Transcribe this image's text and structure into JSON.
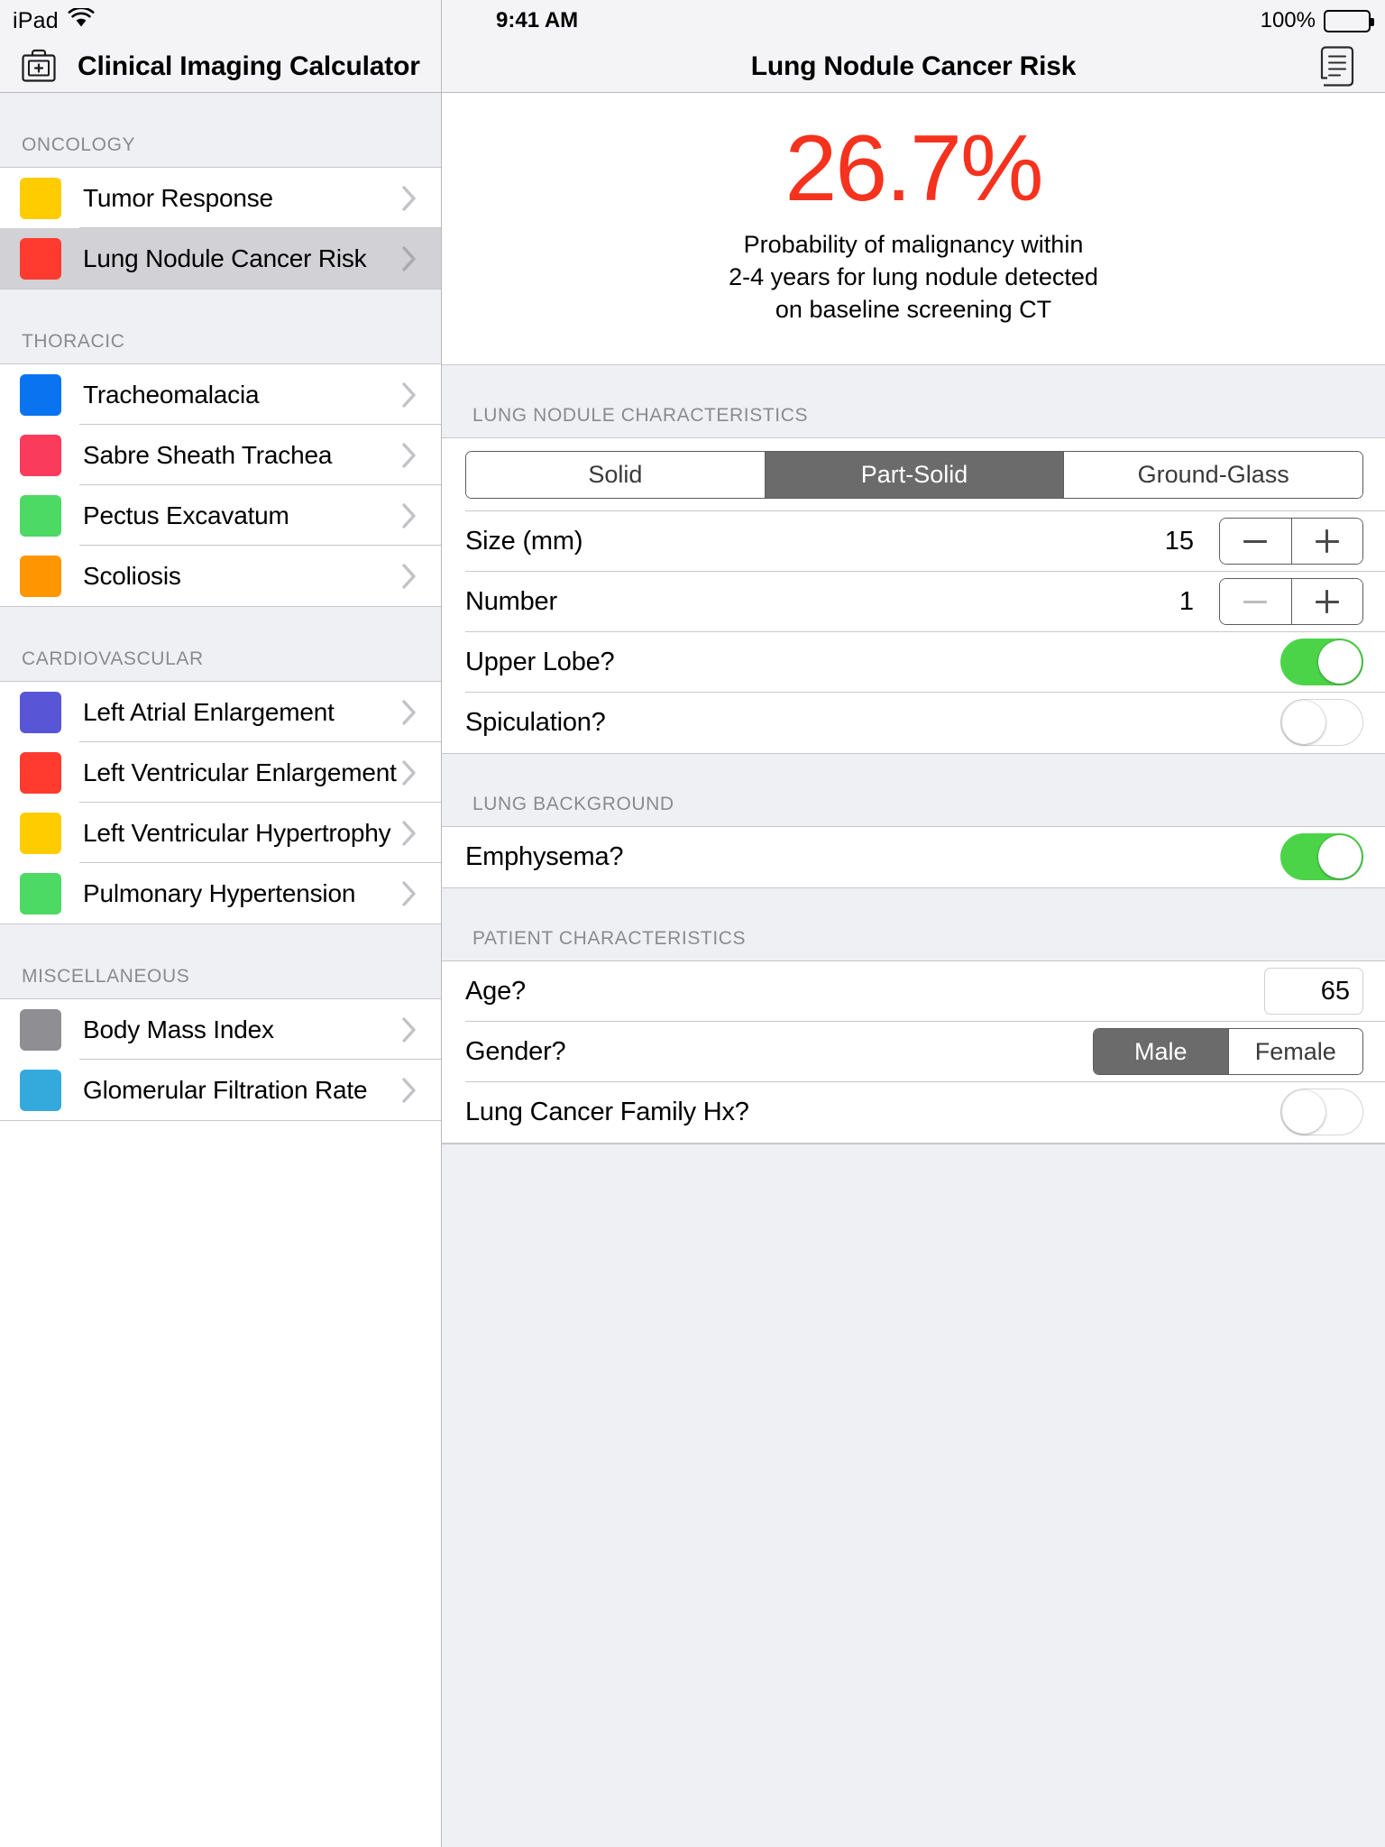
{
  "sidebar": {
    "status": {
      "device": "iPad",
      "wifi_icon": "wifi-icon"
    },
    "app_icon": "medical-bag-icon",
    "title": "Clinical Imaging Calculator",
    "sections": [
      {
        "header": "ONCOLOGY",
        "items": [
          {
            "label": "Tumor Response",
            "color": "#FFCC00",
            "selected": false
          },
          {
            "label": "Lung Nodule Cancer Risk",
            "color": "#FF3B30",
            "selected": true
          }
        ]
      },
      {
        "header": "THORACIC",
        "items": [
          {
            "label": "Tracheomalacia",
            "color": "#0A74F0",
            "selected": false
          },
          {
            "label": "Sabre Sheath Trachea",
            "color": "#FB3B5C",
            "selected": false
          },
          {
            "label": "Pectus Excavatum",
            "color": "#4CD964",
            "selected": false
          },
          {
            "label": "Scoliosis",
            "color": "#FF9500",
            "selected": false
          }
        ]
      },
      {
        "header": "CARDIOVASCULAR",
        "items": [
          {
            "label": "Left Atrial Enlargement",
            "color": "#5856D6",
            "selected": false
          },
          {
            "label": "Left Ventricular Enlargement",
            "color": "#FF3B30",
            "selected": false
          },
          {
            "label": "Left Ventricular Hypertrophy",
            "color": "#FFCC00",
            "selected": false
          },
          {
            "label": "Pulmonary Hypertension",
            "color": "#4CD964",
            "selected": false
          }
        ]
      },
      {
        "header": "MISCELLANEOUS",
        "items": [
          {
            "label": "Body Mass Index",
            "color": "#8E8E93",
            "selected": false
          },
          {
            "label": "Glomerular Filtration Rate",
            "color": "#34AADC",
            "selected": false
          }
        ]
      }
    ]
  },
  "detail": {
    "status": {
      "clock": "9:41 AM",
      "battery_pct": "100%",
      "battery_icon": "battery-full-icon"
    },
    "title": "Lung Nodule Cancer Risk",
    "doc_button_icon": "document-scroll-icon",
    "result": {
      "percent": "26.7%",
      "percent_color": "#F5321E",
      "description_line1": "Probability of malignancy within",
      "description_line2": "2-4 years for lung nodule detected",
      "description_line3": "on baseline screening CT"
    },
    "groups": [
      {
        "header": "LUNG NODULE CHARACTERISTICS",
        "nodule_type": {
          "options": [
            "Solid",
            "Part-Solid",
            "Ground-Glass"
          ],
          "selected": "Part-Solid"
        },
        "size": {
          "label": "Size (mm)",
          "value": "15",
          "minus": "−",
          "plus": "+",
          "minus_disabled": false
        },
        "number": {
          "label": "Number",
          "value": "1",
          "minus": "−",
          "plus": "+",
          "minus_disabled": true
        },
        "upper_lobe": {
          "label": "Upper Lobe?",
          "value": "on"
        },
        "spiculation": {
          "label": "Spiculation?",
          "value": "off"
        }
      },
      {
        "header": "LUNG BACKGROUND",
        "emphysema": {
          "label": "Emphysema?",
          "value": "on"
        }
      },
      {
        "header": "PATIENT CHARACTERISTICS",
        "age": {
          "label": "Age?",
          "value": "65"
        },
        "gender": {
          "label": "Gender?",
          "options": [
            "Male",
            "Female"
          ],
          "selected": "Male"
        },
        "family_hx": {
          "label": "Lung Cancer Family Hx?",
          "value": "off"
        }
      }
    ]
  }
}
